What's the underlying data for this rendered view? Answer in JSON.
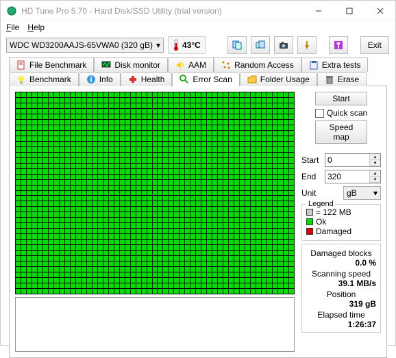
{
  "window": {
    "title": "HD Tune Pro 5.70 - Hard Disk/SSD Utility (trial version)"
  },
  "menu": {
    "file": "File",
    "help": "Help"
  },
  "toolbar": {
    "drive": "WDC WD3200AAJS-65VWA0 (320 gB)",
    "temp": "43°C",
    "exit": "Exit"
  },
  "tabs_row1": [
    {
      "label": "File Benchmark"
    },
    {
      "label": "Disk monitor"
    },
    {
      "label": "AAM"
    },
    {
      "label": "Random Access"
    },
    {
      "label": "Extra tests"
    }
  ],
  "tabs_row2": [
    {
      "label": "Benchmark"
    },
    {
      "label": "Info"
    },
    {
      "label": "Health"
    },
    {
      "label": "Error Scan"
    },
    {
      "label": "Folder Usage"
    },
    {
      "label": "Erase"
    }
  ],
  "side": {
    "start_btn": "Start",
    "quick_scan": "Quick scan",
    "speed_map": "Speed map",
    "start_label": "Start",
    "start_val": "0",
    "end_label": "End",
    "end_val": "320",
    "unit_label": "Unit",
    "unit_val": "gB",
    "legend_title": "Legend",
    "legend_size": "= 122 MB",
    "legend_ok": "Ok",
    "legend_damaged": "Damaged",
    "stats": {
      "damaged_label": "Damaged blocks",
      "damaged_val": "0.0 %",
      "speed_label": "Scanning speed",
      "speed_val": "39.1 MB/s",
      "pos_label": "Position",
      "pos_val": "319 gB",
      "elapsed_label": "Elapsed time",
      "elapsed_val": "1:26:37"
    }
  }
}
